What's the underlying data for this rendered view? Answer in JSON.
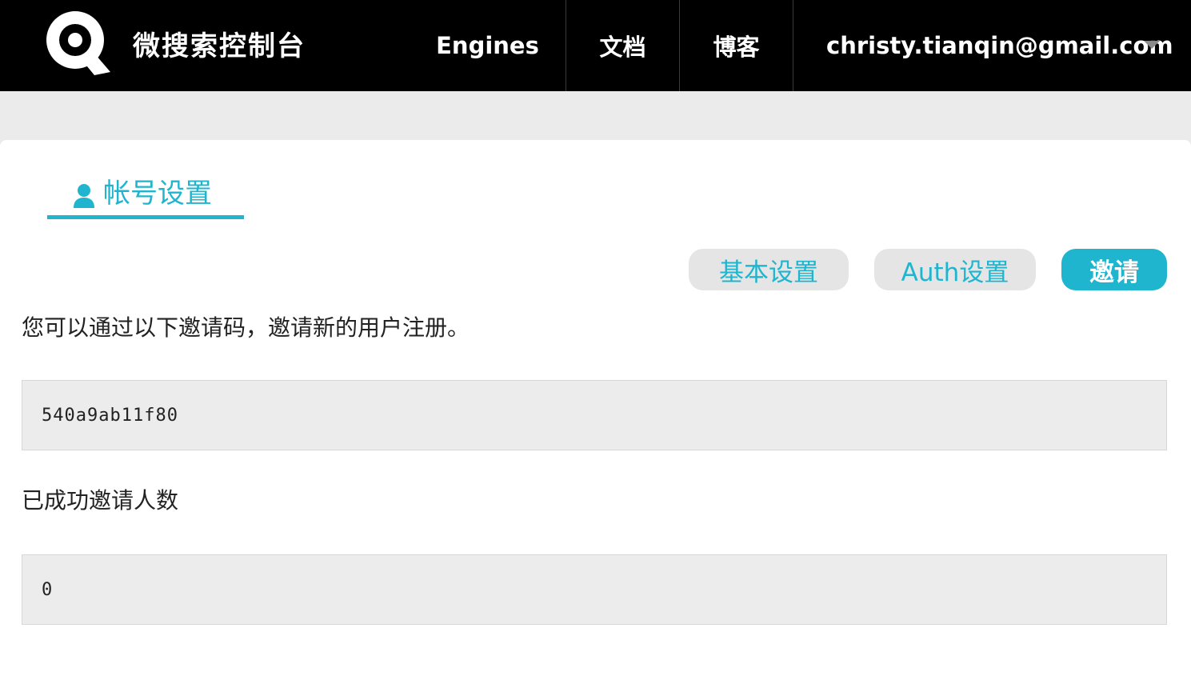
{
  "header": {
    "brand": "微搜索控制台",
    "nav": {
      "engines": "Engines",
      "docs": "文档",
      "blog": "博客",
      "user_email": "christy.tianqin@gmail.com"
    }
  },
  "account": {
    "tab_title": "帐号设置",
    "pills": {
      "basic": "基本设置",
      "auth": "Auth设置",
      "invite": "邀请"
    },
    "invite_desc": "您可以通过以下邀请码，邀请新的用户注册。",
    "invite_code": "540a9ab11f80",
    "invited_count_label": "已成功邀请人数",
    "invited_count": "0"
  },
  "colors": {
    "accent": "#1fb5cf",
    "topbar": "#000000",
    "background": "#ebebeb"
  },
  "icons": {
    "logo": "search-q-logo-icon",
    "user": "user-icon",
    "dropdown": "chevron-down-icon"
  }
}
